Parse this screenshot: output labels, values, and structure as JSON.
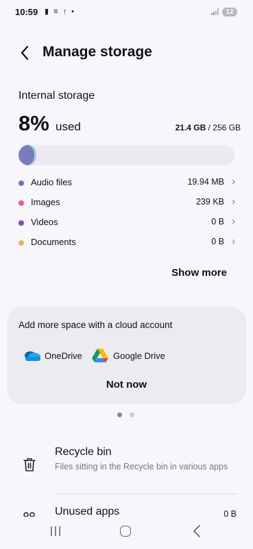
{
  "status_bar": {
    "time": "10:59",
    "icons": "▮ ≡ ↑ •",
    "battery": "12"
  },
  "header": {
    "title": "Manage storage"
  },
  "storage": {
    "section_label": "Internal storage",
    "percent": "8%",
    "used_label": "used",
    "used_amount": "21.4 GB",
    "total_amount": " / 256 GB",
    "fill_fraction": 0.08,
    "categories": [
      {
        "label": "Audio files",
        "size": "19.94 MB",
        "color": "#6b74d6"
      },
      {
        "label": "Images",
        "size": "239 KB",
        "color": "#e85a8a"
      },
      {
        "label": "Videos",
        "size": "0 B",
        "color": "#8a45d0"
      },
      {
        "label": "Documents",
        "size": "0 B",
        "color": "#e3b55c"
      }
    ],
    "show_more": "Show more"
  },
  "cloud": {
    "title": "Add more space with a cloud account",
    "options": [
      {
        "label": "OneDrive",
        "icon": "onedrive-icon"
      },
      {
        "label": "Google Drive",
        "icon": "google-drive-icon"
      }
    ],
    "dismiss": "Not now"
  },
  "pager": {
    "pages": 2,
    "active": 0
  },
  "items": {
    "recycle_title": "Recycle bin",
    "recycle_desc": "Files sitting in the Recycle bin in various apps",
    "unused_title": "Unused apps",
    "unused_size": "0 B"
  }
}
